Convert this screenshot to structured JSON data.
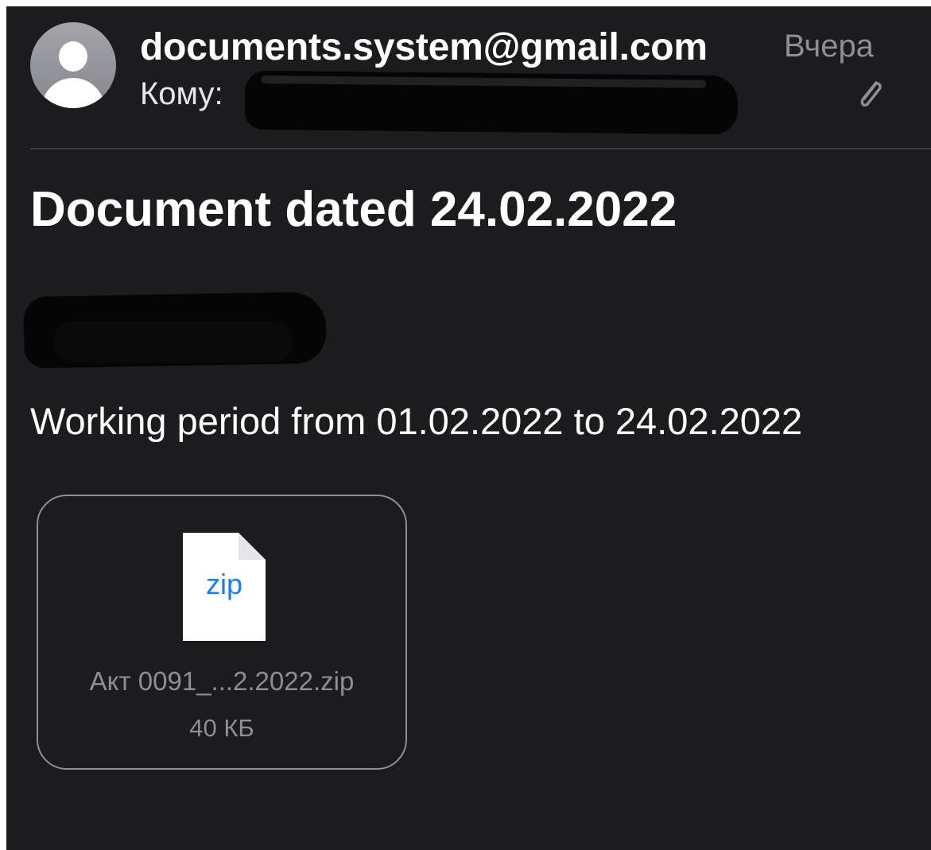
{
  "header": {
    "sender": "documents.system@gmail.com",
    "date": "Вчера",
    "to_label": "Кому:",
    "icons": {
      "avatar": "person-avatar-icon",
      "attachment": "paperclip-icon"
    }
  },
  "message": {
    "subject": "Document dated 24.02.2022",
    "body": "Working period from 01.02.2022 to 24.02.2022"
  },
  "attachment": {
    "extension": "zip",
    "file_name": "Акт 0091_...2.2022.zip",
    "file_size": "40 КБ",
    "icon": "zip-file-icon"
  },
  "colors": {
    "background": "#1c1c1e",
    "primary_text": "#ffffff",
    "secondary_text": "#8e8e93",
    "zip_label": "#1a7cf5",
    "redaction": "#050505"
  }
}
